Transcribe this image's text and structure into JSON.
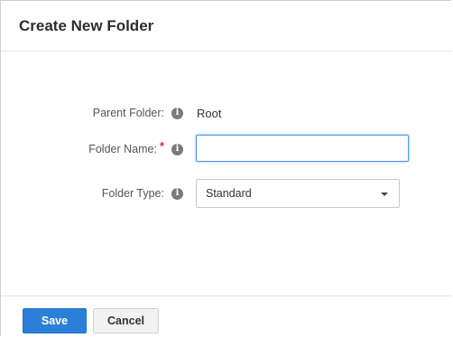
{
  "dialog": {
    "title": "Create New Folder"
  },
  "form": {
    "parent_folder": {
      "label": "Parent Folder:",
      "value": "Root"
    },
    "folder_name": {
      "label": "Folder Name:",
      "required_mark": "*",
      "value": "",
      "placeholder": ""
    },
    "folder_type": {
      "label": "Folder Type:",
      "selected": "Standard"
    },
    "info_glyph": "i"
  },
  "footer": {
    "save_label": "Save",
    "cancel_label": "Cancel"
  },
  "colors": {
    "primary_button": "#2b7fd9",
    "focus_border": "#4a90e2",
    "required": "#d32f2f"
  },
  "icons": [
    "info-icon",
    "chevron-down-icon"
  ]
}
